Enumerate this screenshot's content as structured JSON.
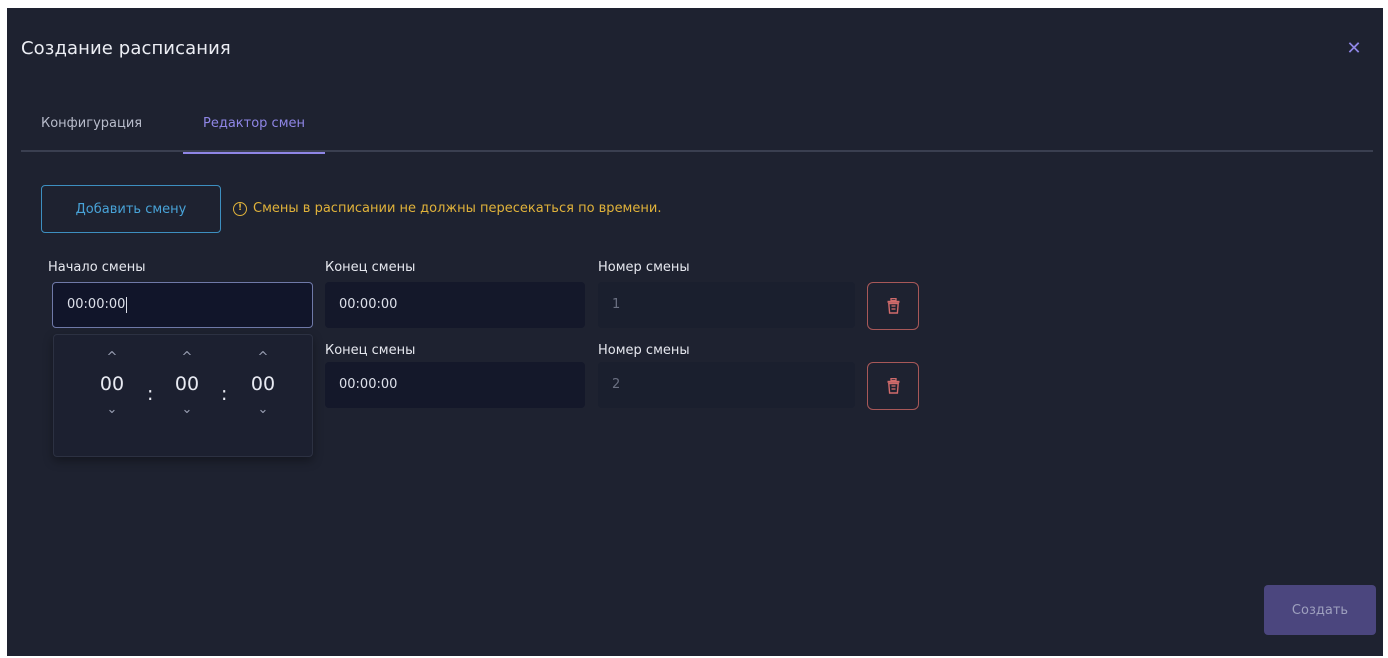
{
  "dialog": {
    "title": "Создание расписания",
    "close_icon": "close-icon"
  },
  "tabs": [
    {
      "label": "Конфигурация",
      "active": false
    },
    {
      "label": "Редактор смен",
      "active": true
    }
  ],
  "toolbar": {
    "add_shift_label": "Добавить смену",
    "warning_icon": "info-circle-icon",
    "warning_text": "Смены в расписании не должны пересекаться по времени."
  },
  "shifts": [
    {
      "start_label": "Начало смены",
      "start_value": "00:00:00",
      "end_label": "Конец смены",
      "end_value": "00:00:00",
      "number_label": "Номер смены",
      "number_value": "1"
    },
    {
      "end_label": "Конец смены",
      "end_value": "00:00:00",
      "number_label": "Номер смены",
      "number_value": "2"
    }
  ],
  "time_picker": {
    "hours": "00",
    "minutes": "00",
    "seconds": "00",
    "separator": ":",
    "up_glyph": "^",
    "down_glyph": "⌄"
  },
  "footer": {
    "create_label": "Создать"
  },
  "colors": {
    "background": "#1e2230",
    "accent": "#8f86e6",
    "warning": "#e0b23a",
    "danger": "#a85858",
    "link": "#48a3d8"
  }
}
